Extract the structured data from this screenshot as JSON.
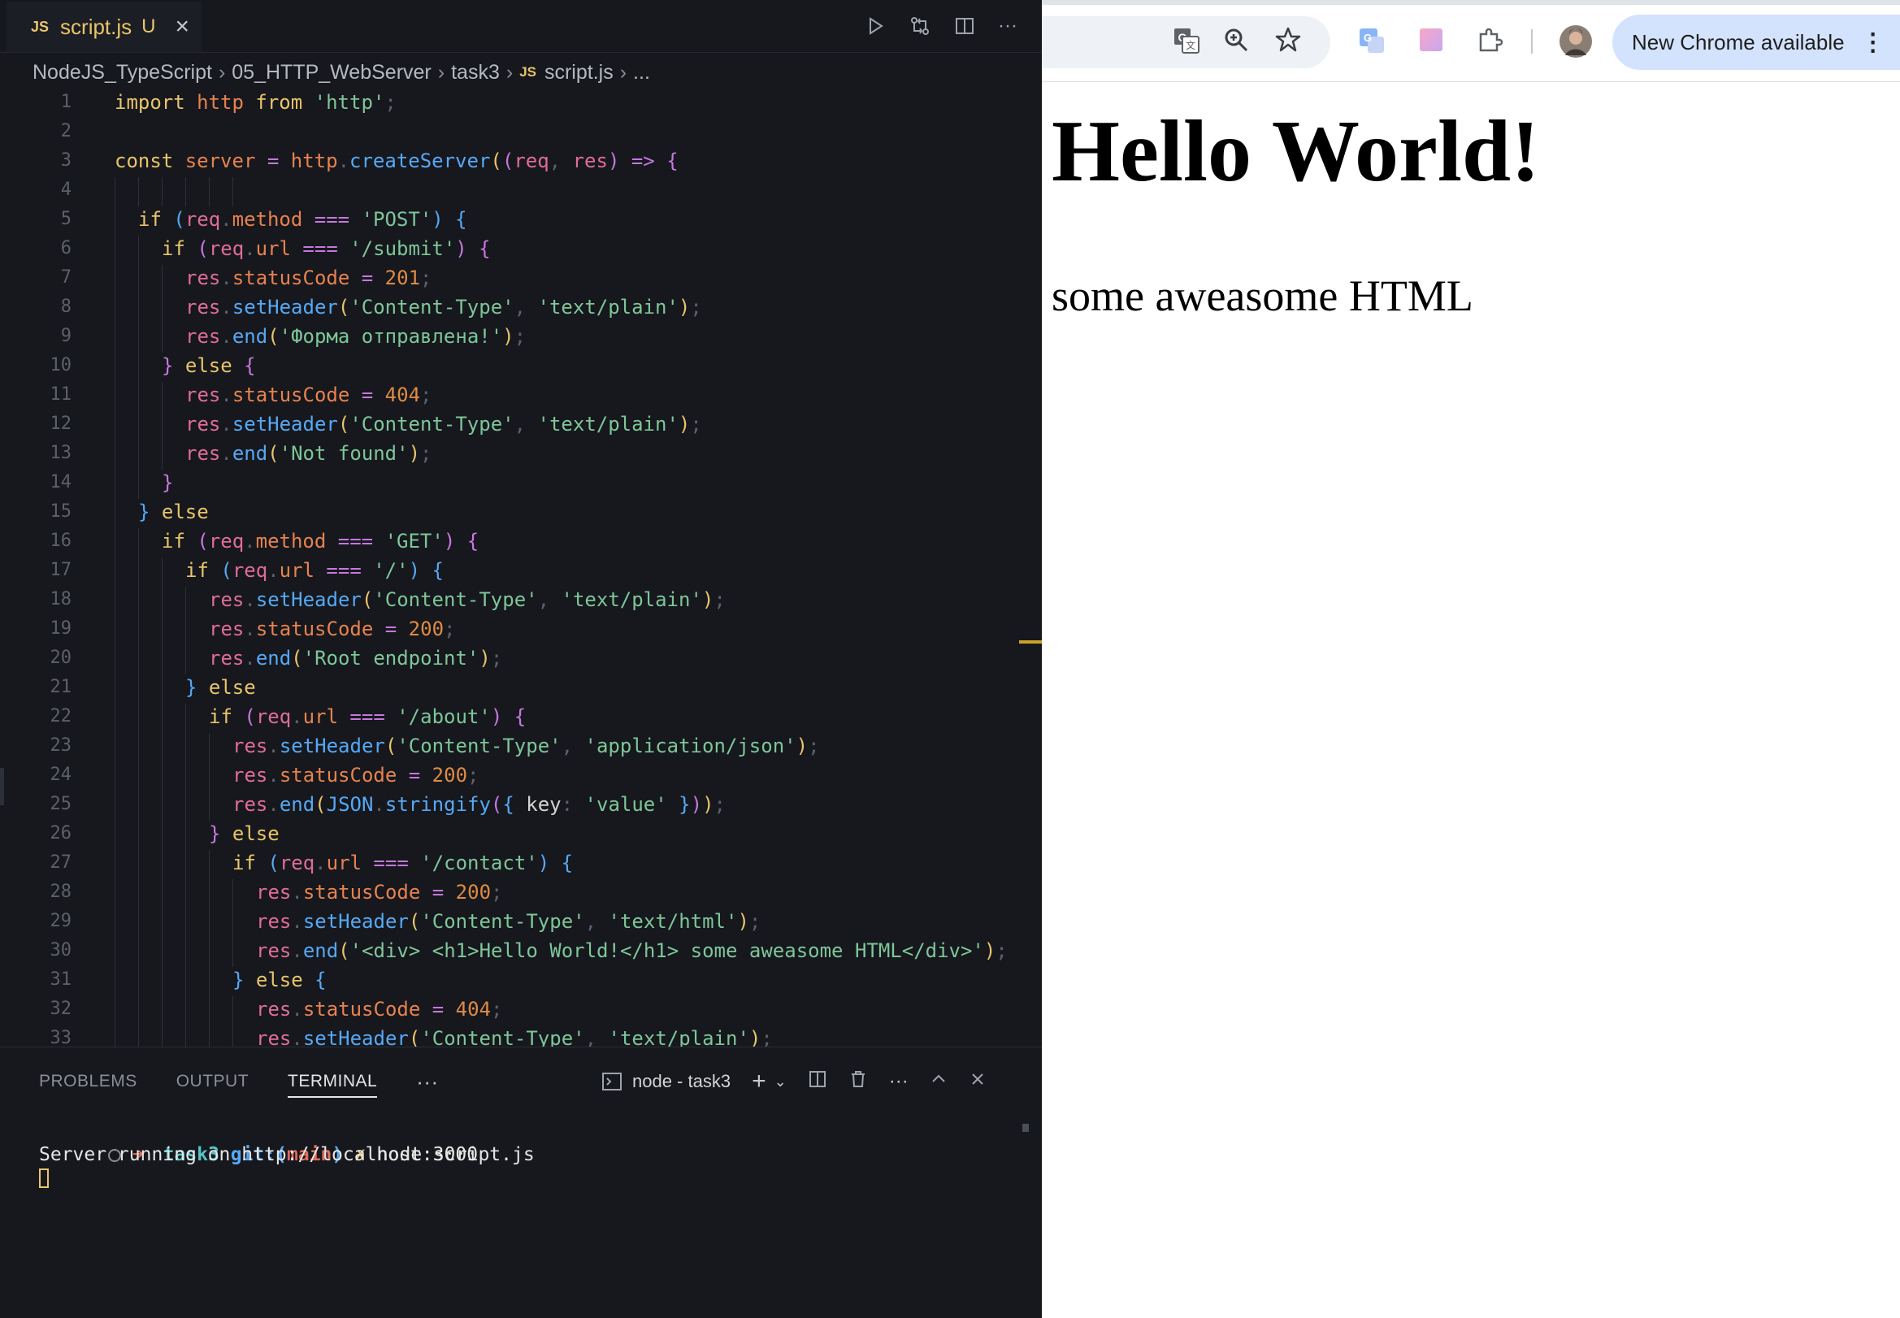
{
  "editor": {
    "tab": {
      "badge": "JS",
      "filename": "script.js",
      "status": "U"
    },
    "breadcrumb": [
      "NodeJS_TypeScript",
      "05_HTTP_WebServer",
      "task3",
      "script.js",
      "..."
    ],
    "breadcrumb_badge": "JS",
    "lines": [
      {
        "n": "1",
        "indent": 0,
        "tokens": [
          [
            "kw",
            "import "
          ],
          [
            "var",
            "http "
          ],
          [
            "kw",
            "from "
          ],
          [
            "str",
            "'http'"
          ],
          [
            "pn",
            ";"
          ]
        ]
      },
      {
        "n": "2",
        "indent": 0,
        "tokens": []
      },
      {
        "n": "3",
        "indent": 0,
        "tokens": [
          [
            "kw",
            "const "
          ],
          [
            "var",
            "server "
          ],
          [
            "op",
            "= "
          ],
          [
            "var",
            "http"
          ],
          [
            "pn",
            "."
          ],
          [
            "fn",
            "createServer"
          ],
          [
            "br1",
            "("
          ],
          [
            "br2",
            "("
          ],
          [
            "prm",
            "req"
          ],
          [
            "pn",
            ", "
          ],
          [
            "prm",
            "res"
          ],
          [
            "br2",
            ")"
          ],
          [
            "op",
            " => "
          ],
          [
            "br2",
            "{"
          ]
        ]
      },
      {
        "n": "4",
        "indent": 0,
        "tokens": []
      },
      {
        "n": "5",
        "indent": 1,
        "tokens": [
          [
            "kw",
            "if "
          ],
          [
            "br3",
            "("
          ],
          [
            "prm",
            "req"
          ],
          [
            "pn",
            "."
          ],
          [
            "var",
            "method "
          ],
          [
            "op",
            "=== "
          ],
          [
            "str",
            "'POST'"
          ],
          [
            "br3",
            ")"
          ],
          [
            "br3",
            " {"
          ]
        ]
      },
      {
        "n": "6",
        "indent": 2,
        "tokens": [
          [
            "kw",
            "if "
          ],
          [
            "br2",
            "("
          ],
          [
            "prm",
            "req"
          ],
          [
            "pn",
            "."
          ],
          [
            "var",
            "url "
          ],
          [
            "op",
            "=== "
          ],
          [
            "str",
            "'/submit'"
          ],
          [
            "br2",
            ")"
          ],
          [
            "br2",
            " {"
          ]
        ]
      },
      {
        "n": "7",
        "indent": 3,
        "tokens": [
          [
            "prm",
            "res"
          ],
          [
            "pn",
            "."
          ],
          [
            "var",
            "statusCode "
          ],
          [
            "op",
            "= "
          ],
          [
            "num",
            "201"
          ],
          [
            "pn",
            ";"
          ]
        ]
      },
      {
        "n": "8",
        "indent": 3,
        "tokens": [
          [
            "prm",
            "res"
          ],
          [
            "pn",
            "."
          ],
          [
            "fn",
            "setHeader"
          ],
          [
            "br1",
            "("
          ],
          [
            "str",
            "'Content-Type'"
          ],
          [
            "pn",
            ", "
          ],
          [
            "str",
            "'text/plain'"
          ],
          [
            "br1",
            ")"
          ],
          [
            "pn",
            ";"
          ]
        ]
      },
      {
        "n": "9",
        "indent": 3,
        "tokens": [
          [
            "prm",
            "res"
          ],
          [
            "pn",
            "."
          ],
          [
            "fn",
            "end"
          ],
          [
            "br1",
            "("
          ],
          [
            "str",
            "'Форма отправлена!'"
          ],
          [
            "br1",
            ")"
          ],
          [
            "pn",
            ";"
          ]
        ]
      },
      {
        "n": "10",
        "indent": 2,
        "tokens": [
          [
            "br2",
            "} "
          ],
          [
            "kw",
            "else "
          ],
          [
            "br2",
            "{"
          ]
        ]
      },
      {
        "n": "11",
        "indent": 3,
        "tokens": [
          [
            "prm",
            "res"
          ],
          [
            "pn",
            "."
          ],
          [
            "var",
            "statusCode "
          ],
          [
            "op",
            "= "
          ],
          [
            "num",
            "404"
          ],
          [
            "pn",
            ";"
          ]
        ]
      },
      {
        "n": "12",
        "indent": 3,
        "tokens": [
          [
            "prm",
            "res"
          ],
          [
            "pn",
            "."
          ],
          [
            "fn",
            "setHeader"
          ],
          [
            "br1",
            "("
          ],
          [
            "str",
            "'Content-Type'"
          ],
          [
            "pn",
            ", "
          ],
          [
            "str",
            "'text/plain'"
          ],
          [
            "br1",
            ")"
          ],
          [
            "pn",
            ";"
          ]
        ]
      },
      {
        "n": "13",
        "indent": 3,
        "tokens": [
          [
            "prm",
            "res"
          ],
          [
            "pn",
            "."
          ],
          [
            "fn",
            "end"
          ],
          [
            "br1",
            "("
          ],
          [
            "str",
            "'Not found'"
          ],
          [
            "br1",
            ")"
          ],
          [
            "pn",
            ";"
          ]
        ]
      },
      {
        "n": "14",
        "indent": 2,
        "tokens": [
          [
            "br2",
            "}"
          ]
        ]
      },
      {
        "n": "15",
        "indent": 1,
        "tokens": [
          [
            "br3",
            "} "
          ],
          [
            "kw",
            "else"
          ]
        ]
      },
      {
        "n": "16",
        "indent": 2,
        "tokens": [
          [
            "kw",
            "if "
          ],
          [
            "br2",
            "("
          ],
          [
            "prm",
            "req"
          ],
          [
            "pn",
            "."
          ],
          [
            "var",
            "method "
          ],
          [
            "op",
            "=== "
          ],
          [
            "str",
            "'GET'"
          ],
          [
            "br2",
            ")"
          ],
          [
            "br2",
            " {"
          ]
        ]
      },
      {
        "n": "17",
        "indent": 3,
        "tokens": [
          [
            "kw",
            "if "
          ],
          [
            "br3",
            "("
          ],
          [
            "prm",
            "req"
          ],
          [
            "pn",
            "."
          ],
          [
            "var",
            "url "
          ],
          [
            "op",
            "=== "
          ],
          [
            "str",
            "'/'"
          ],
          [
            "br3",
            ")"
          ],
          [
            "br3",
            " {"
          ]
        ]
      },
      {
        "n": "18",
        "indent": 4,
        "tokens": [
          [
            "prm",
            "res"
          ],
          [
            "pn",
            "."
          ],
          [
            "fn",
            "setHeader"
          ],
          [
            "br1",
            "("
          ],
          [
            "str",
            "'Content-Type'"
          ],
          [
            "pn",
            ", "
          ],
          [
            "str",
            "'text/plain'"
          ],
          [
            "br1",
            ")"
          ],
          [
            "pn",
            ";"
          ]
        ]
      },
      {
        "n": "19",
        "indent": 4,
        "tokens": [
          [
            "prm",
            "res"
          ],
          [
            "pn",
            "."
          ],
          [
            "var",
            "statusCode "
          ],
          [
            "op",
            "= "
          ],
          [
            "num",
            "200"
          ],
          [
            "pn",
            ";"
          ]
        ]
      },
      {
        "n": "20",
        "indent": 4,
        "tokens": [
          [
            "prm",
            "res"
          ],
          [
            "pn",
            "."
          ],
          [
            "fn",
            "end"
          ],
          [
            "br1",
            "("
          ],
          [
            "str",
            "'Root endpoint'"
          ],
          [
            "br1",
            ")"
          ],
          [
            "pn",
            ";"
          ]
        ]
      },
      {
        "n": "21",
        "indent": 3,
        "tokens": [
          [
            "br3",
            "} "
          ],
          [
            "kw",
            "else"
          ]
        ]
      },
      {
        "n": "22",
        "indent": 4,
        "tokens": [
          [
            "kw",
            "if "
          ],
          [
            "br2",
            "("
          ],
          [
            "prm",
            "req"
          ],
          [
            "pn",
            "."
          ],
          [
            "var",
            "url "
          ],
          [
            "op",
            "=== "
          ],
          [
            "str",
            "'/about'"
          ],
          [
            "br2",
            ")"
          ],
          [
            "br2",
            " {"
          ]
        ]
      },
      {
        "n": "23",
        "indent": 5,
        "tokens": [
          [
            "prm",
            "res"
          ],
          [
            "pn",
            "."
          ],
          [
            "fn",
            "setHeader"
          ],
          [
            "br1",
            "("
          ],
          [
            "str",
            "'Content-Type'"
          ],
          [
            "pn",
            ", "
          ],
          [
            "str",
            "'application/json'"
          ],
          [
            "br1",
            ")"
          ],
          [
            "pn",
            ";"
          ]
        ]
      },
      {
        "n": "24",
        "indent": 5,
        "tokens": [
          [
            "prm",
            "res"
          ],
          [
            "pn",
            "."
          ],
          [
            "var",
            "statusCode "
          ],
          [
            "op",
            "= "
          ],
          [
            "num",
            "200"
          ],
          [
            "pn",
            ";"
          ]
        ]
      },
      {
        "n": "25",
        "indent": 5,
        "tokens": [
          [
            "prm",
            "res"
          ],
          [
            "pn",
            "."
          ],
          [
            "fn",
            "end"
          ],
          [
            "br1",
            "("
          ],
          [
            "obj",
            "JSON"
          ],
          [
            "pn",
            "."
          ],
          [
            "fn",
            "stringify"
          ],
          [
            "br2",
            "("
          ],
          [
            "br3",
            "{ "
          ],
          [
            "pl",
            "key"
          ],
          [
            "pn",
            ": "
          ],
          [
            "str",
            "'value'"
          ],
          [
            "br3",
            " }"
          ],
          [
            "br2",
            ")"
          ],
          [
            "br1",
            ")"
          ],
          [
            "pn",
            ";"
          ]
        ]
      },
      {
        "n": "26",
        "indent": 4,
        "tokens": [
          [
            "br2",
            "} "
          ],
          [
            "kw",
            "else"
          ]
        ]
      },
      {
        "n": "27",
        "indent": 5,
        "tokens": [
          [
            "kw",
            "if "
          ],
          [
            "br3",
            "("
          ],
          [
            "prm",
            "req"
          ],
          [
            "pn",
            "."
          ],
          [
            "var",
            "url "
          ],
          [
            "op",
            "=== "
          ],
          [
            "str",
            "'/contact'"
          ],
          [
            "br3",
            ")"
          ],
          [
            "br3",
            " {"
          ]
        ]
      },
      {
        "n": "28",
        "indent": 6,
        "tokens": [
          [
            "prm",
            "res"
          ],
          [
            "pn",
            "."
          ],
          [
            "var",
            "statusCode "
          ],
          [
            "op",
            "= "
          ],
          [
            "num",
            "200"
          ],
          [
            "pn",
            ";"
          ]
        ]
      },
      {
        "n": "29",
        "indent": 6,
        "tokens": [
          [
            "prm",
            "res"
          ],
          [
            "pn",
            "."
          ],
          [
            "fn",
            "setHeader"
          ],
          [
            "br1",
            "("
          ],
          [
            "str",
            "'Content-Type'"
          ],
          [
            "pn",
            ", "
          ],
          [
            "str",
            "'text/html'"
          ],
          [
            "br1",
            ")"
          ],
          [
            "pn",
            ";"
          ]
        ]
      },
      {
        "n": "30",
        "indent": 6,
        "tokens": [
          [
            "prm",
            "res"
          ],
          [
            "pn",
            "."
          ],
          [
            "fn",
            "end"
          ],
          [
            "br1",
            "("
          ],
          [
            "str",
            "'<div> <h1>Hello World!</h1> some aweasome HTML</div>'"
          ],
          [
            "br1",
            ")"
          ],
          [
            "pn",
            ";"
          ]
        ]
      },
      {
        "n": "31",
        "indent": 5,
        "tokens": [
          [
            "br3",
            "} "
          ],
          [
            "kw",
            "else "
          ],
          [
            "br3",
            "{"
          ]
        ]
      },
      {
        "n": "32",
        "indent": 6,
        "tokens": [
          [
            "prm",
            "res"
          ],
          [
            "pn",
            "."
          ],
          [
            "var",
            "statusCode "
          ],
          [
            "op",
            "= "
          ],
          [
            "num",
            "404"
          ],
          [
            "pn",
            ";"
          ]
        ]
      },
      {
        "n": "33",
        "indent": 6,
        "tokens": [
          [
            "prm",
            "res"
          ],
          [
            "pn",
            "."
          ],
          [
            "fn",
            "setHeader"
          ],
          [
            "br1",
            "("
          ],
          [
            "str",
            "'Content-Type'"
          ],
          [
            "pn",
            ", "
          ],
          [
            "str",
            "'text/plain'"
          ],
          [
            "br1",
            ")"
          ],
          [
            "pn",
            ";"
          ]
        ]
      }
    ]
  },
  "panel": {
    "tabs": [
      "PROBLEMS",
      "OUTPUT",
      "TERMINAL"
    ],
    "active_tab": "TERMINAL",
    "more": "···",
    "terminal_name": "node - task3",
    "terminal": {
      "prompt_arrow": "➜",
      "dir": "task3",
      "git_label": "git:(",
      "branch": "main",
      "git_close": ")",
      "dirty_mark": "✗",
      "command": "node script.js",
      "output": "Server running on http://localhost:3000"
    }
  },
  "browser": {
    "update_button": "New Chrome available",
    "page": {
      "heading": "Hello World!",
      "body_text": "some aweasome HTML"
    }
  }
}
